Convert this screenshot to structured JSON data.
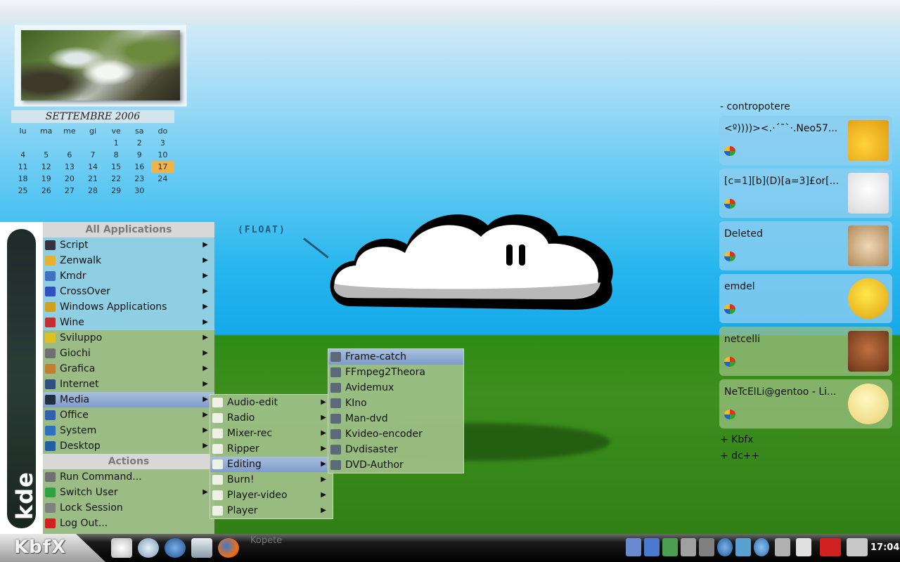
{
  "calendar": {
    "title": "SETTEMBRE 2006",
    "weekdays": [
      "lu",
      "ma",
      "me",
      "gi",
      "ve",
      "sa",
      "do"
    ],
    "weeks": [
      [
        "",
        "",
        "",
        "",
        "1",
        "2",
        "3"
      ],
      [
        "4",
        "5",
        "6",
        "7",
        "8",
        "9",
        "10"
      ],
      [
        "11",
        "12",
        "13",
        "14",
        "15",
        "16",
        "17"
      ],
      [
        "18",
        "19",
        "20",
        "21",
        "22",
        "23",
        "24"
      ],
      [
        "25",
        "26",
        "27",
        "28",
        "29",
        "30",
        ""
      ]
    ],
    "today": "17"
  },
  "float_label": "(FLOAT)",
  "start_menu": {
    "brand": "kde",
    "all_apps_header": "All Applications",
    "items": [
      {
        "label": "Script",
        "icon": "script-icon",
        "color": "#334"
      },
      {
        "label": "Zenwalk",
        "icon": "zenwalk-icon",
        "color": "#e8b030"
      },
      {
        "label": "Kmdr",
        "icon": "kmdr-icon",
        "color": "#4070c0"
      },
      {
        "label": "CrossOver",
        "icon": "crossover-icon",
        "color": "#3050c0"
      },
      {
        "label": "Windows Applications",
        "icon": "windows-folder-icon",
        "color": "#d0a020"
      },
      {
        "label": "Wine",
        "icon": "wine-icon",
        "color": "#c03030"
      },
      {
        "label": "Sviluppo",
        "icon": "development-icon",
        "color": "#e0c020"
      },
      {
        "label": "Giochi",
        "icon": "games-icon",
        "color": "#707070"
      },
      {
        "label": "Grafica",
        "icon": "graphics-icon",
        "color": "#c08030"
      },
      {
        "label": "Internet",
        "icon": "internet-icon",
        "color": "#305080"
      },
      {
        "label": "Media",
        "icon": "media-icon",
        "color": "#203040"
      },
      {
        "label": "Office",
        "icon": "office-icon",
        "color": "#3060b0"
      },
      {
        "label": "System",
        "icon": "system-icon",
        "color": "#3070c0"
      },
      {
        "label": "Desktop",
        "icon": "desktop-icon",
        "color": "#2060a0"
      }
    ],
    "actions_header": "Actions",
    "actions": [
      {
        "label": "Run Command...",
        "icon": "run-command-icon",
        "color": "#707070"
      },
      {
        "label": "Switch User",
        "icon": "switch-user-icon",
        "color": "#30a040"
      },
      {
        "label": "Lock Session",
        "icon": "lock-icon",
        "color": "#808080"
      },
      {
        "label": "Log Out...",
        "icon": "logout-icon",
        "color": "#d02020"
      }
    ]
  },
  "media_submenu": [
    "Audio-edit",
    "Radio",
    "Mixer-rec",
    "Ripper",
    "Editing",
    "Burn!",
    "Player-video",
    "Player"
  ],
  "editing_submenu": [
    {
      "label": "Frame-catch",
      "icon": "frame-catch-icon"
    },
    {
      "label": "FFmpeg2Theora",
      "icon": "ffmpeg-icon"
    },
    {
      "label": "Avidemux",
      "icon": "avidemux-icon"
    },
    {
      "label": "KIno",
      "icon": "kino-icon"
    },
    {
      "label": "Man-dvd",
      "icon": "man-dvd-icon"
    },
    {
      "label": "Kvideo-encoder",
      "icon": "kvideo-encoder-icon"
    },
    {
      "label": "Dvdisaster",
      "icon": "dvdisaster-icon"
    },
    {
      "label": "DVD-Author",
      "icon": "dvd-author-icon"
    }
  ],
  "contacts": {
    "group_header": "- contropotere",
    "list": [
      {
        "name": "<º))))><.·´¯`·.Neo57...",
        "status": "msn-online-icon",
        "avatar": "mercury-avatar",
        "style": "blue"
      },
      {
        "name": "[c=1][b](D)[a=3]£or[...",
        "status": "msn-away-icon",
        "avatar": "penguin-avatar",
        "style": "blue"
      },
      {
        "name": "Deleted",
        "status": "msn-online-icon",
        "avatar": "creature-avatar",
        "style": "blue"
      },
      {
        "name": "emdel",
        "status": "msn-online-icon",
        "avatar": "smiley-avatar",
        "style": "blue"
      },
      {
        "name": "netcelli",
        "status": "msn-online-icon",
        "avatar": "goomba-avatar",
        "style": "green"
      },
      {
        "name": "NeTcElLi@gentoo - Li...",
        "status": "msn-away-icon",
        "avatar": "pale-smiley-avatar",
        "style": "green"
      }
    ],
    "collapsed_groups": [
      "+ Kbfx",
      "+ dc++"
    ]
  },
  "taskbar": {
    "start_label": "KbfX",
    "kopete_task": "Kopete",
    "clock": "17:04"
  }
}
